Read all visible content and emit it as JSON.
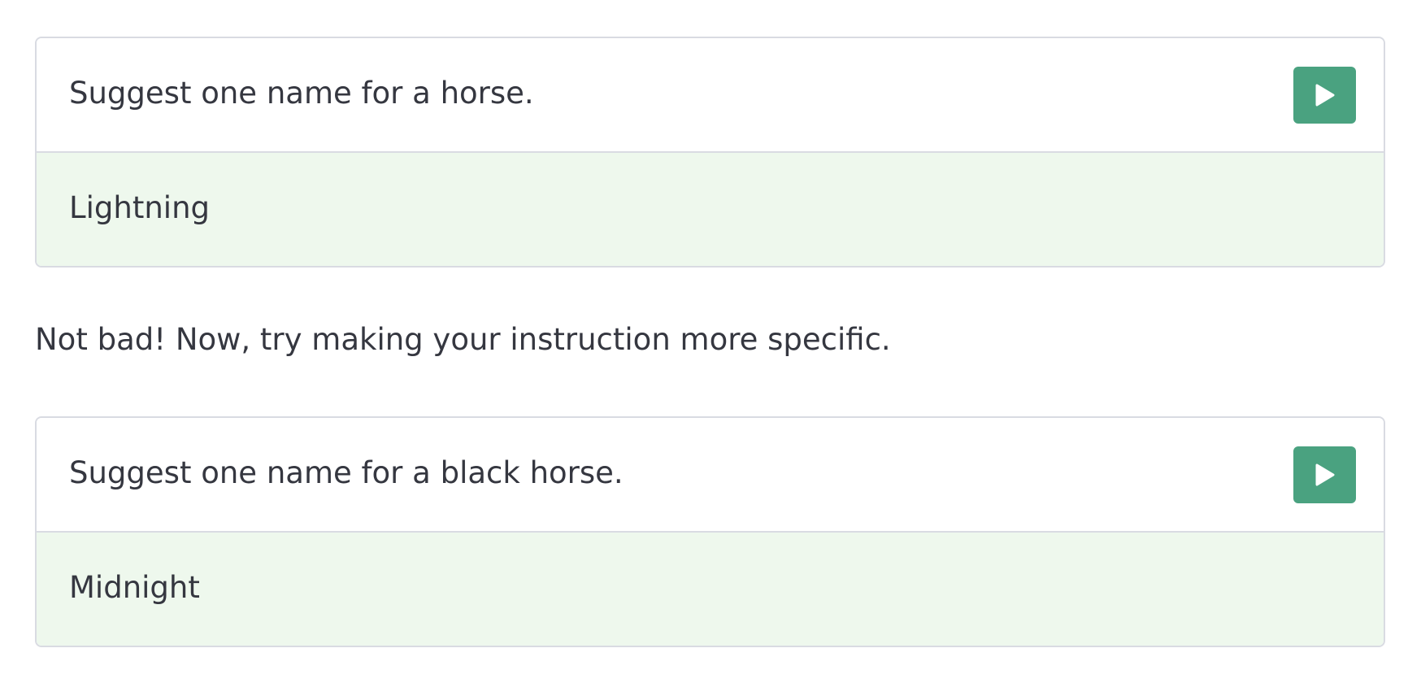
{
  "examples": [
    {
      "prompt": "Suggest one name for a horse.",
      "response": "Lightning"
    },
    {
      "prompt": "Suggest one name for a black horse.",
      "response": "Midnight"
    }
  ],
  "guide_text": "Not bad! Now, try making your instruction more specific.",
  "run_button": {
    "icon": "play-icon"
  },
  "colors": {
    "accent": "#4aa280",
    "response_background": "#eef8ed",
    "border": "#d9dbe2",
    "text": "#353740"
  }
}
